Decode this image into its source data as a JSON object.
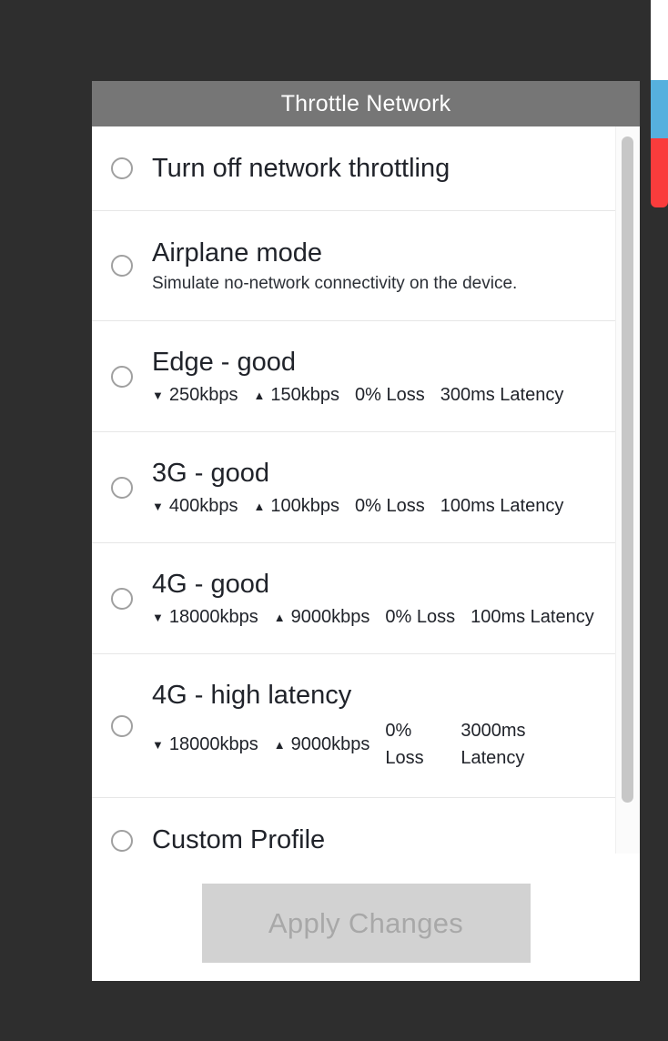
{
  "colors": {
    "backdrop": "#2e2e2e",
    "header_bg": "#767676",
    "dialog_bg": "#ffffff",
    "button_bg": "#d2d2d2",
    "button_text": "#a8a8a8",
    "edge_blue": "#56b0de",
    "edge_red": "#fa3c3c"
  },
  "dialog": {
    "title": "Throttle Network",
    "options": [
      {
        "title": "Turn off network throttling",
        "selected": false
      },
      {
        "title": "Airplane mode",
        "subtitle": "Simulate no-network connectivity on the device.",
        "selected": false
      },
      {
        "title": "Edge - good",
        "selected": false,
        "metrics": {
          "download_icon": "triangle-down-icon",
          "download": "250kbps",
          "upload_icon": "triangle-up-icon",
          "upload": "150kbps",
          "loss": "0% Loss",
          "loss_value": "0%",
          "loss_label": "Loss",
          "latency": "300ms Latency",
          "latency_value": "300ms",
          "latency_label": "Latency"
        }
      },
      {
        "title": "3G - good",
        "selected": false,
        "metrics": {
          "download_icon": "triangle-down-icon",
          "download": "400kbps",
          "upload_icon": "triangle-up-icon",
          "upload": "100kbps",
          "loss": "0% Loss",
          "latency": "100ms Latency"
        }
      },
      {
        "title": "4G - good",
        "selected": false,
        "metrics": {
          "download_icon": "triangle-down-icon",
          "download": "18000kbps",
          "upload_icon": "triangle-up-icon",
          "upload": "9000kbps",
          "loss": "0% Loss",
          "latency": "100ms Latency"
        }
      },
      {
        "title": "4G - high latency",
        "selected": false,
        "metrics": {
          "download_icon": "triangle-down-icon",
          "download": "18000kbps",
          "upload_icon": "triangle-up-icon",
          "upload": "9000kbps",
          "loss_value": "0%",
          "loss_label": "Loss",
          "latency_value": "3000ms",
          "latency_label": "Latency"
        }
      },
      {
        "title": "Custom Profile",
        "selected": false
      }
    ],
    "apply_button": {
      "label": "Apply Changes",
      "enabled": false
    }
  }
}
